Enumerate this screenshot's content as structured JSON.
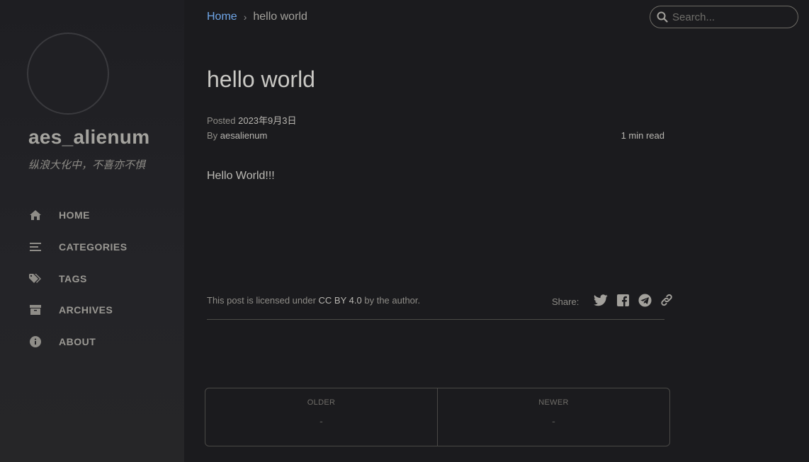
{
  "sidebar": {
    "title": "aes_alienum",
    "subtitle": "纵浪大化中，不喜亦不惧",
    "items": [
      {
        "label": "HOME",
        "icon": "home-icon"
      },
      {
        "label": "CATEGORIES",
        "icon": "list-icon"
      },
      {
        "label": "TAGS",
        "icon": "tags-icon"
      },
      {
        "label": "ARCHIVES",
        "icon": "archive-icon"
      },
      {
        "label": "ABOUT",
        "icon": "info-icon"
      }
    ]
  },
  "breadcrumb": {
    "home": "Home",
    "separator": "›",
    "current": "hello world"
  },
  "search": {
    "placeholder": "Search..."
  },
  "post": {
    "title": "hello world",
    "posted_label": "Posted",
    "posted_date": "2023年9月3日",
    "by_label": "By",
    "author": "aesalienum",
    "read_time": "1 min read",
    "body": "Hello World!!!"
  },
  "license": {
    "prefix": "This post is licensed under",
    "link": "CC BY 4.0",
    "suffix": "by the author."
  },
  "share": {
    "label": "Share:",
    "icons": [
      "twitter-icon",
      "facebook-icon",
      "telegram-icon",
      "link-icon"
    ]
  },
  "post_nav": {
    "older_label": "OLDER",
    "older_title": "-",
    "newer_label": "NEWER",
    "newer_title": "-"
  },
  "colors": {
    "background": "#1b1b1e",
    "sidebar": "#232327",
    "link": "#6fa5e6",
    "text": "#c9c8c4"
  }
}
